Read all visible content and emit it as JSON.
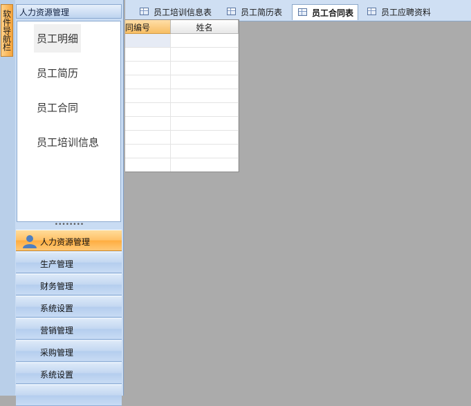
{
  "side_tab": {
    "label": "软件导航栏"
  },
  "nav": {
    "header": "人力资源管理",
    "items": [
      {
        "label": "员工明细",
        "active": true
      },
      {
        "label": "员工简历",
        "active": false
      },
      {
        "label": "员工合同",
        "active": false
      },
      {
        "label": "员工培训信息",
        "active": false
      }
    ],
    "splitter": "••••••••",
    "groups": [
      {
        "label": "人力资源管理",
        "active": true,
        "icon": "user-icon"
      },
      {
        "label": "生产管理",
        "active": false
      },
      {
        "label": "财务管理",
        "active": false
      },
      {
        "label": "系统设置",
        "active": false
      },
      {
        "label": "营销管理",
        "active": false
      },
      {
        "label": "采购管理",
        "active": false
      },
      {
        "label": "系统设置",
        "active": false
      }
    ]
  },
  "tabs": [
    {
      "label": "员工培训信息表",
      "active": false,
      "icon": "table-icon"
    },
    {
      "label": "员工简历表",
      "active": false,
      "icon": "table-icon"
    },
    {
      "label": "员工合同表",
      "active": true,
      "icon": "table-icon"
    },
    {
      "label": "员工应聘资料",
      "active": false,
      "icon": "table-icon"
    }
  ],
  "grid": {
    "columns": [
      "合同编号",
      "姓名"
    ],
    "visible_first_column_text": "同编号",
    "row_count": 10
  },
  "colors": {
    "accent_orange": "#ffc066",
    "panel_blue": "#c9dcf3",
    "workspace_gray": "#ababab"
  }
}
